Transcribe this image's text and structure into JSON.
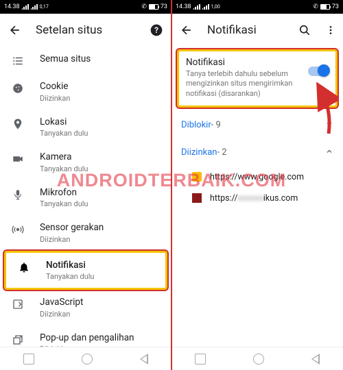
{
  "status": {
    "time": "14.38",
    "net": "0,17",
    "batt": "73",
    "net2": "1,00"
  },
  "left": {
    "title": "Setelan situs",
    "items": [
      {
        "label": "Semua situs",
        "sub": ""
      },
      {
        "label": "Cookie",
        "sub": "Diizinkan"
      },
      {
        "label": "Lokasi",
        "sub": "Tanyakan dulu"
      },
      {
        "label": "Kamera",
        "sub": "Tanyakan dulu"
      },
      {
        "label": "Mikrofon",
        "sub": "Tanyakan dulu"
      },
      {
        "label": "Sensor gerakan",
        "sub": "Diizinkan"
      },
      {
        "label": "Notifikasi",
        "sub": "Tanyakan dulu"
      },
      {
        "label": "JavaScript",
        "sub": "Diizinkan"
      },
      {
        "label": "Pop-up dan pengalihan",
        "sub": "Diblokir"
      }
    ]
  },
  "right": {
    "title": "Notifikasi",
    "card": {
      "heading": "Notifikasi",
      "desc": "Tanya terlebih dahulu sebelum mengizinkan situs mengirimkan notifikasi (disarankan)"
    },
    "blocked": {
      "label": "Diblokir",
      "count": " - 9"
    },
    "allowed": {
      "label": "Diizinkan",
      "count": " - 2"
    },
    "sites": [
      {
        "url": "https://www.google.com"
      },
      {
        "url_pre": "https://",
        "url_hidden": "xxxxxx",
        "url_post": "ikus.com"
      }
    ]
  },
  "watermark": "ANDROIDTERBAIK.COM"
}
